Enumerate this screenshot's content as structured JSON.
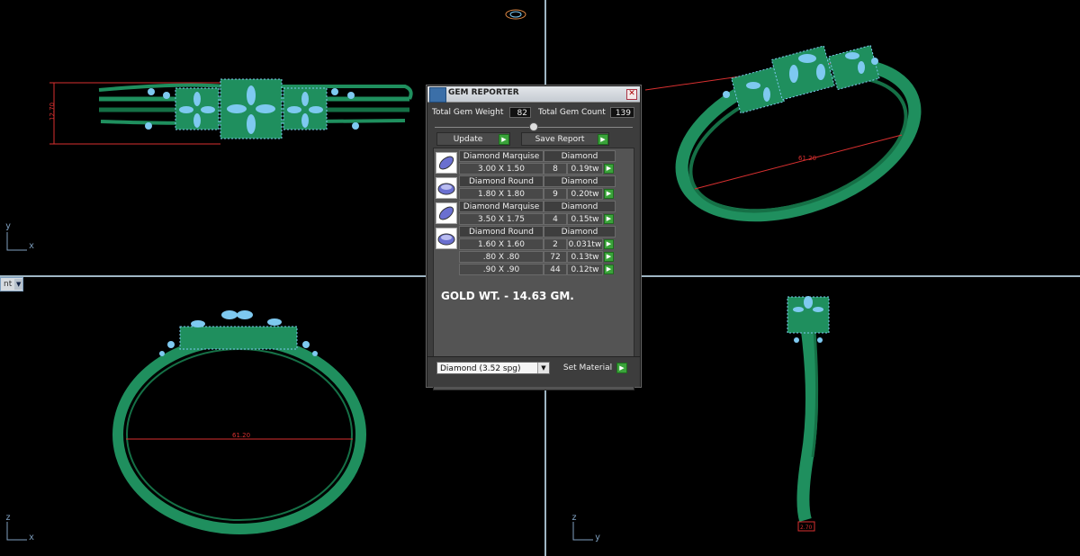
{
  "panel": {
    "title": "GEM REPORTER",
    "close_glyph": "✕",
    "total_gem_weight_label": "Total Gem Weight",
    "total_gem_weight_value": "82",
    "total_gem_count_label": "Total Gem Count",
    "total_gem_count_value": "139",
    "update_label": "Update",
    "save_report_label": "Save Report",
    "go_glyph": "▶",
    "gem_blocks": [
      {
        "icon": "marquise-gem-icon",
        "type": "Diamond Marquise",
        "material": "Diamond",
        "rows": [
          {
            "size": "3.00 X 1.50",
            "count": "8",
            "weight": "0.19tw"
          }
        ]
      },
      {
        "icon": "round-gem-icon",
        "type": "Diamond Round",
        "material": "Diamond",
        "rows": [
          {
            "size": "1.80 X 1.80",
            "count": "9",
            "weight": "0.20tw"
          }
        ]
      },
      {
        "icon": "marquise-gem-icon",
        "type": "Diamond Marquise",
        "material": "Diamond",
        "rows": [
          {
            "size": "3.50 X 1.75",
            "count": "4",
            "weight": "0.15tw"
          }
        ]
      },
      {
        "icon": "round-gem-icon",
        "type": "Diamond Round",
        "material": "Diamond",
        "rows": [
          {
            "size": "1.60 X 1.60",
            "count": "2",
            "weight": "0.031tw"
          },
          {
            "size": ".80 X .80",
            "count": "72",
            "weight": "0.13tw"
          },
          {
            "size": ".90 X .90",
            "count": "44",
            "weight": "0.12tw"
          }
        ]
      }
    ],
    "gold_weight_note": "GOLD WT. - 14.63 GM.",
    "material_select_value": "Diamond       (3.52 spg)",
    "dropdown_glyph": "▼",
    "set_material_label": "Set Material"
  },
  "viewports": {
    "top_left_axes": [
      "y",
      "x"
    ],
    "top_right_axes": [],
    "bottom_left_axes": [
      "z",
      "x"
    ],
    "bottom_right_axes": [
      "z",
      "y"
    ],
    "bottom_left_dropdown": "nt",
    "dimension_top_left": "12.70",
    "dimension_top_right": "61.20",
    "dimension_bottom_left": "61.20",
    "dimension_bottom_right": "2.70"
  },
  "colors": {
    "metal": "#1f8f5e",
    "metal_dark": "#157046",
    "gem": "#7ec9f0",
    "dimension": "#d83030",
    "panel_bg": "#3d3d3d"
  }
}
